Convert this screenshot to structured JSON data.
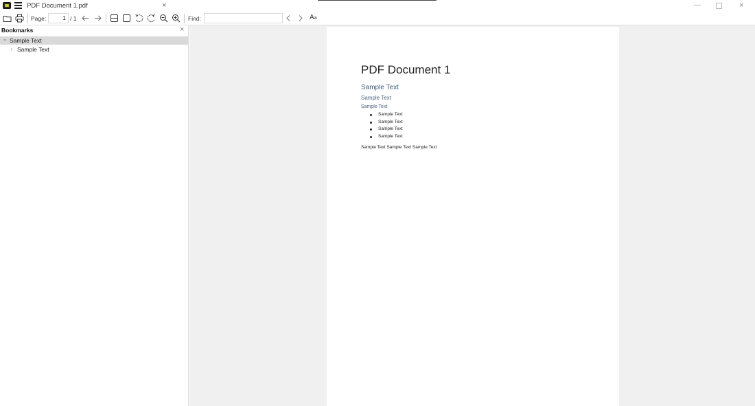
{
  "titlebar": {
    "tab_title": "PDF Document 1.pdf",
    "tab_close": "×",
    "minimize": "—",
    "close": "×"
  },
  "toolbar": {
    "page_label": "Page:",
    "page_value": "1",
    "page_total": "/ 1",
    "find_label": "Find:",
    "find_value": "",
    "aa_label": "A",
    "aa_small": "a"
  },
  "bookmarks": {
    "title": "Bookmarks",
    "close": "×",
    "items": [
      {
        "label": "Sample Text",
        "chevron": "⌄",
        "selected": true
      },
      {
        "label": "Sample Text",
        "chevron": "›",
        "selected": false
      }
    ]
  },
  "document": {
    "title": "PDF Document 1",
    "heading2": "Sample Text",
    "heading3": "Sample Text",
    "heading4": "Sample Text",
    "list": [
      "Sample Text",
      "Sample Text",
      "Sample Text",
      "Sample Text"
    ],
    "paragraph": "Sample Text Sample Text Sample Text"
  },
  "colors": {
    "viewer_background": "#f0f0f0",
    "page_background": "#ffffff",
    "selected_row": "#d9d9d9",
    "heading_blue": "#3c5a7a"
  }
}
